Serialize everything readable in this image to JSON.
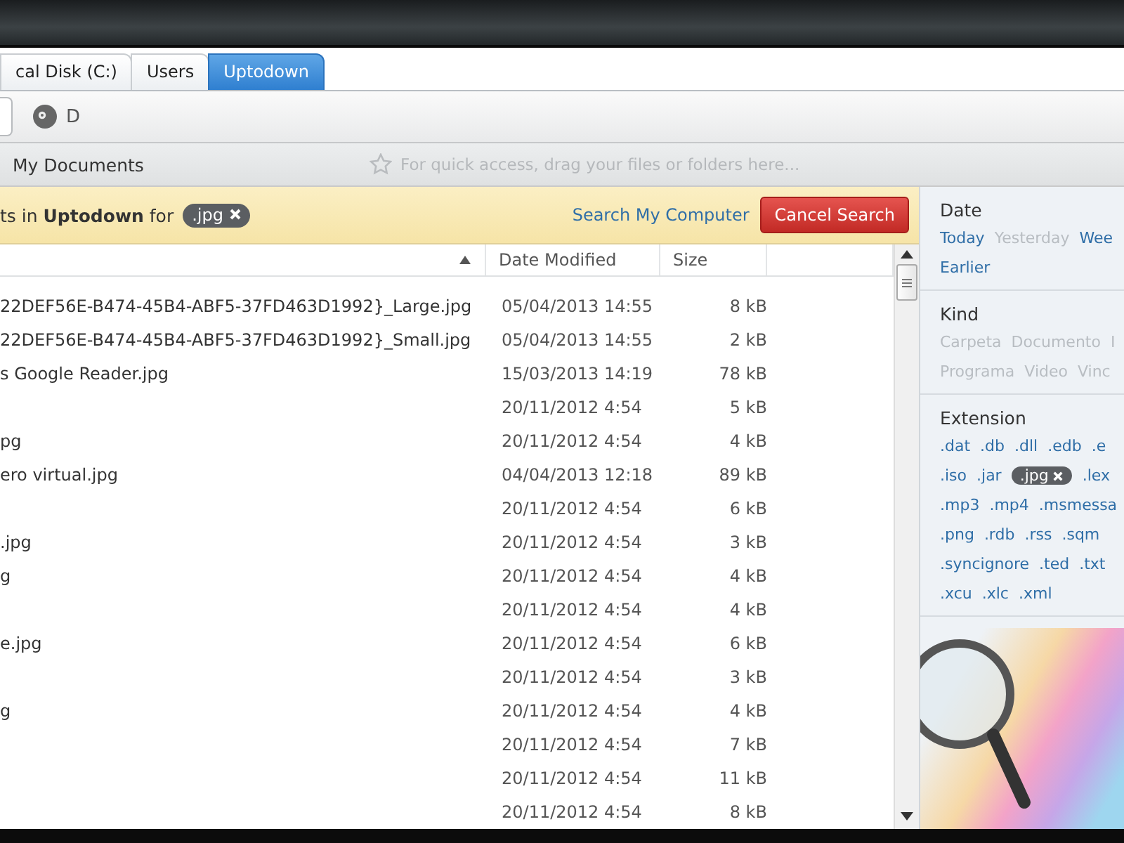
{
  "breadcrumb": [
    {
      "label": "cal Disk (C:)",
      "selected": false
    },
    {
      "label": "Users",
      "selected": false
    },
    {
      "label": "Uptodown",
      "selected": true
    }
  ],
  "toolbar": {
    "drive_label": "D"
  },
  "favorites": {
    "items": [
      "My Documents"
    ],
    "placeholder": "For quick access, drag your files or folders here..."
  },
  "search_bar": {
    "message": "ts in **Uptodown** for",
    "query_chip": ".jpg",
    "link": "Search My Computer",
    "button": "Cancel Search"
  },
  "file_list": {
    "columns": [
      {
        "sorted": true
      },
      {
        "label": "Date Modified"
      },
      {
        "label": "Size"
      }
    ],
    "rows": [
      {
        "name": "22DEF56E-B474-45B4-ABF5-37FD463D1992}_Large.jpg",
        "modified": "05/04/2013 14:55",
        "size": "8 kB"
      },
      {
        "name": "22DEF56E-B474-45B4-ABF5-37FD463D1992}_Small.jpg",
        "modified": "05/04/2013 14:55",
        "size": "2 kB"
      },
      {
        "name": "s Google Reader.jpg",
        "modified": "15/03/2013 14:19",
        "size": "78 kB"
      },
      {
        "modified": "20/11/2012 4:54",
        "size": "5 kB"
      },
      {
        "name": "pg",
        "modified": "20/11/2012 4:54",
        "size": "4 kB"
      },
      {
        "name": "ero virtual.jpg",
        "modified": "04/04/2013 12:18",
        "size": "89 kB"
      },
      {
        "modified": "20/11/2012 4:54",
        "size": "6 kB"
      },
      {
        "name": ".jpg",
        "modified": "20/11/2012 4:54",
        "size": "3 kB"
      },
      {
        "name": "g",
        "modified": "20/11/2012 4:54",
        "size": "4 kB"
      },
      {
        "modified": "20/11/2012 4:54",
        "size": "4 kB"
      },
      {
        "name": "e.jpg",
        "modified": "20/11/2012 4:54",
        "size": "6 kB"
      },
      {
        "modified": "20/11/2012 4:54",
        "size": "3 kB"
      },
      {
        "name": "g",
        "modified": "20/11/2012 4:54",
        "size": "4 kB"
      },
      {
        "modified": "20/11/2012 4:54",
        "size": "7 kB"
      },
      {
        "modified": "20/11/2012 4:54",
        "size": "11 kB"
      },
      {
        "modified": "20/11/2012 4:54",
        "size": "8 kB"
      }
    ]
  },
  "filters": [
    {
      "title": "Date",
      "lines": [
        {
          "items": [
            {
              "label": "Today",
              "disabled": false,
              "selected": false
            },
            {
              "label": "Yesterday",
              "disabled": true,
              "selected": false
            },
            {
              "label": "Wee",
              "disabled": false,
              "selected": false
            }
          ]
        },
        {
          "items": [
            {
              "label": "Earlier",
              "disabled": false,
              "selected": false
            }
          ]
        }
      ]
    },
    {
      "title": "Kind",
      "lines": [
        {
          "items": [
            {
              "label": "Carpeta",
              "disabled": true,
              "selected": false
            },
            {
              "label": "Documento",
              "disabled": true,
              "selected": false
            },
            {
              "label": "I",
              "disabled": true,
              "selected": false
            }
          ]
        },
        {
          "items": [
            {
              "label": "Programa",
              "disabled": true,
              "selected": false
            },
            {
              "label": "Video",
              "disabled": true,
              "selected": false
            },
            {
              "label": "Vinc",
              "disabled": true,
              "selected": false
            }
          ]
        }
      ]
    },
    {
      "title": "Extension",
      "lines": [
        {
          "items": [
            {
              "label": ".dat",
              "disabled": false,
              "selected": false
            },
            {
              "label": ".db",
              "disabled": false,
              "selected": false
            },
            {
              "label": ".dll",
              "disabled": false,
              "selected": false
            },
            {
              "label": ".edb",
              "disabled": false,
              "selected": false
            },
            {
              "label": ".e",
              "disabled": false,
              "selected": false
            }
          ]
        },
        {
          "items": [
            {
              "label": ".iso",
              "disabled": false,
              "selected": false
            },
            {
              "label": ".jar",
              "disabled": false,
              "selected": false
            },
            {
              "label": ".jpg",
              "disabled": false,
              "selected": true
            },
            {
              "label": ".lex",
              "disabled": false,
              "selected": false
            }
          ]
        },
        {
          "items": [
            {
              "label": ".mp3",
              "disabled": false,
              "selected": false
            },
            {
              "label": ".mp4",
              "disabled": false,
              "selected": false
            },
            {
              "label": ".msmessa",
              "disabled": false,
              "selected": false
            }
          ]
        },
        {
          "items": [
            {
              "label": ".png",
              "disabled": false,
              "selected": false
            },
            {
              "label": ".rdb",
              "disabled": false,
              "selected": false
            },
            {
              "label": ".rss",
              "disabled": false,
              "selected": false
            },
            {
              "label": ".sqm",
              "disabled": false,
              "selected": false
            }
          ]
        },
        {
          "items": [
            {
              "label": ".syncignore",
              "disabled": false,
              "selected": false
            },
            {
              "label": ".ted",
              "disabled": false,
              "selected": false
            },
            {
              "label": ".txt",
              "disabled": false,
              "selected": false
            }
          ]
        },
        {
          "items": [
            {
              "label": ".xcu",
              "disabled": false,
              "selected": false
            },
            {
              "label": ".xlc",
              "disabled": false,
              "selected": false
            },
            {
              "label": ".xml",
              "disabled": false,
              "selected": false
            }
          ]
        }
      ]
    }
  ]
}
